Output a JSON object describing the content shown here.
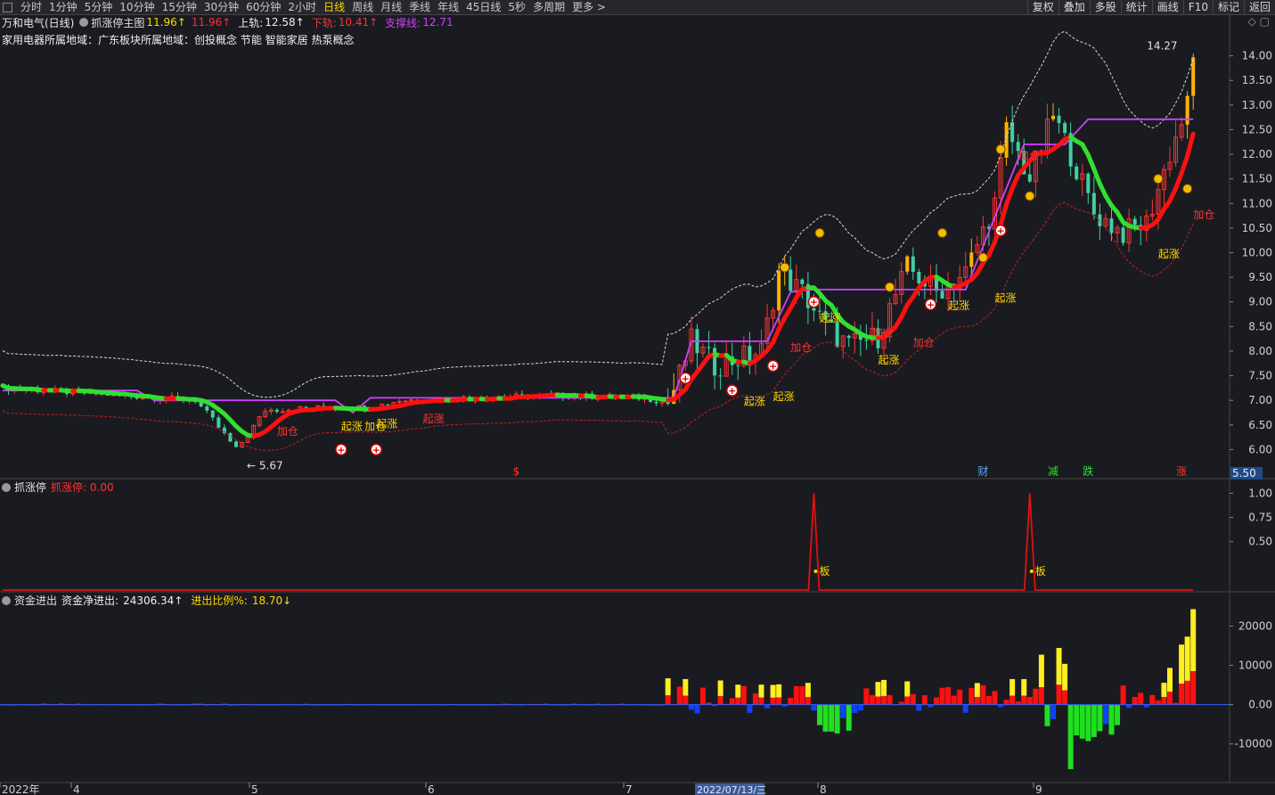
{
  "toolbar": {
    "periods": [
      "分时",
      "1分钟",
      "5分钟",
      "10分钟",
      "15分钟",
      "30分钟",
      "60分钟",
      "2小时",
      "日线",
      "周线",
      "月线",
      "季线",
      "年线",
      "45日线",
      "5秒",
      "多周期",
      "更多 >"
    ],
    "active_period": "日线",
    "right_buttons": [
      "复权",
      "叠加",
      "多股",
      "统计",
      "画线",
      "F10",
      "标记",
      "返回"
    ]
  },
  "header": {
    "stock": "万和电气(日线)",
    "indicator": "抓涨停主图",
    "val1": "11.96↑",
    "val2": "11.96↑",
    "upper_label": "上轨:",
    "upper_value": "12.58↑",
    "lower_label": "下轨:",
    "lower_value": "10.41↑",
    "support_label": "支撑线:",
    "support_value": "12.71",
    "concepts": "家用电器所属地域：广东板块所属地域：创投概念 节能 智能家居 热泵概念"
  },
  "panel2": {
    "name": "抓涨停",
    "label": "抓涨停: 0.00"
  },
  "panel3": {
    "name": "资金进出",
    "net_label": "资金净进出:",
    "net_value": "24306.34↑",
    "ratio_label": "进出比例%:",
    "ratio_value": "18.70↓"
  },
  "colors": {
    "up": "#ff3232",
    "down": "#40d0a0",
    "limit_up": "#ffb300",
    "support": "#d040ff",
    "trend_up": "#ff1010",
    "trend_down": "#30e030",
    "inflow": "#ff1010",
    "inflow_big": "#ffee20",
    "outflow": "#1040ff",
    "outflow_big": "#20e020",
    "price_tag": "#1f4a88"
  },
  "chart_data": [
    {
      "type": "candlestick",
      "title": "抓涨停主图",
      "y_ticks": [
        "14.00",
        "13.50",
        "13.00",
        "12.50",
        "12.00",
        "11.50",
        "11.00",
        "10.50",
        "10.00",
        "9.50",
        "9.00",
        "8.50",
        "8.00",
        "7.50",
        "7.00",
        "6.50",
        "6.00"
      ],
      "ylim": [
        5.5,
        14.5
      ],
      "high_label": "14.27",
      "low_label": "5.67",
      "current_price_tag": "5.50",
      "annotations": [
        "起涨",
        "加仓",
        "起涨",
        "起涨",
        "加仓",
        "起涨",
        "起涨",
        "加仓",
        "起涨",
        "起涨",
        "起涨",
        "加仓",
        "起涨",
        "加仓",
        "加仓",
        "起涨",
        "加仓"
      ],
      "bottom_markers": [
        "$",
        "财",
        "减",
        "跌",
        "涨"
      ]
    },
    {
      "type": "line",
      "title": "抓涨停",
      "y_ticks": [
        "1.00",
        "0.75",
        "0.50"
      ],
      "ylim": [
        0,
        1.05
      ],
      "spike_label": "板"
    },
    {
      "type": "bar",
      "title": "资金进出",
      "y_ticks": [
        "20000",
        "10000",
        "0.00",
        "-10000"
      ],
      "ylim": [
        -18000,
        26000
      ]
    }
  ],
  "xaxis": {
    "ticks": [
      "2022年",
      "4",
      "5",
      "6",
      "7",
      "8",
      "9"
    ],
    "highlight": "2022/07/13/三"
  }
}
